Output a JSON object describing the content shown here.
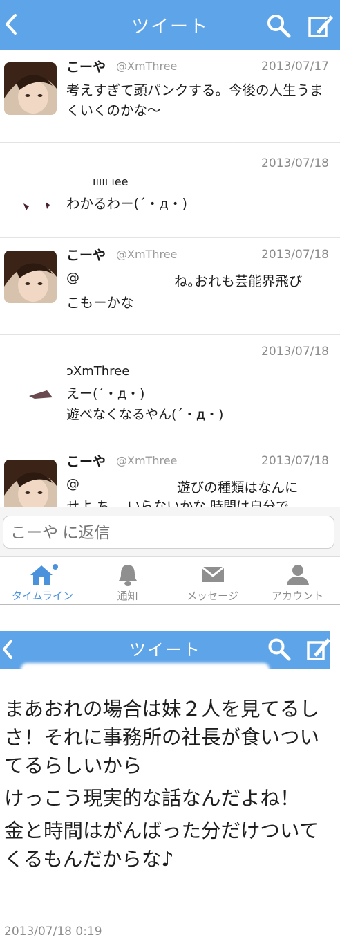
{
  "top": {
    "header": {
      "title": "ツイート"
    },
    "tweets": [
      {
        "name": "こーや",
        "handle": "@XmThree",
        "date": "2013/07/17",
        "text": "考えすぎて頭パンクする。今後の人生うまくいくのかな～"
      },
      {
        "name": "",
        "handle": "",
        "date": "2013/07/18",
        "fragment": "ııııı ıее",
        "text": "わかるわー(´・д・)"
      },
      {
        "name": "こーや",
        "handle": "@XmThree",
        "date": "2013/07/18",
        "mention": "@",
        "text": "ね｡おれも芸能界飛び",
        "text2": "こもーかな"
      },
      {
        "name": "",
        "handle": "",
        "date": "2013/07/18",
        "fragment": "ͻXmThree",
        "line1": "えー(´・д・)",
        "line2": "遊べなくなるやん(´・д・)"
      },
      {
        "name": "こーや",
        "handle": "@XmThree",
        "date": "2013/07/18",
        "mention": "@",
        "text": "遊びの種類はなんに",
        "cut": "せよ ち　 いらないかな 時間は自分で"
      }
    ],
    "reply": {
      "placeholder": "こーや に返信"
    },
    "tabs": [
      {
        "label": "タイムライン",
        "icon": "home-icon"
      },
      {
        "label": "通知",
        "icon": "bell-icon"
      },
      {
        "label": "メッセージ",
        "icon": "envelope-icon"
      },
      {
        "label": "アカウント",
        "icon": "person-icon"
      }
    ]
  },
  "bottom": {
    "header": {
      "title": "ツイート"
    },
    "body": [
      "まあおれの場合は妹２人を見てるしさ！それに事務所の社長が食いついてるらしいから",
      "けっこう現実的な話なんだよね！",
      "金と時間はがんばった分だけついてくるもんだからな♪"
    ],
    "timestamp": "2013/07/18 0:19"
  },
  "colors": {
    "header_blue": "#5ea4e8",
    "tab_active": "#4a92dc",
    "muted": "#8c8c8c"
  }
}
